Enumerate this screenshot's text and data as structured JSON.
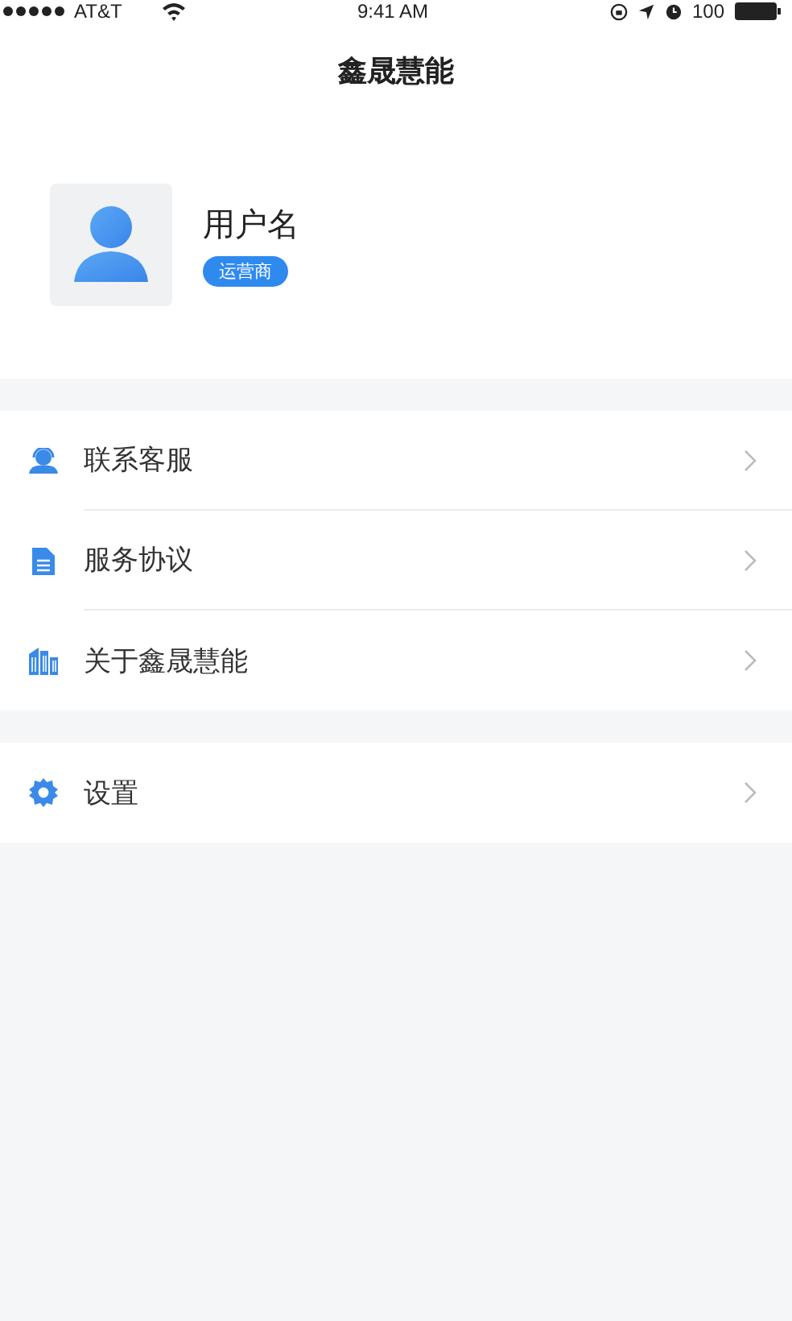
{
  "status_bar": {
    "carrier": "AT&T",
    "time": "9:41 AM",
    "battery": "100"
  },
  "nav_bar": {
    "title": "鑫晟慧能"
  },
  "profile": {
    "name": "用户名",
    "role_badge": "运营商"
  },
  "menu_groups": [
    {
      "items": [
        {
          "kind": "support",
          "label": "联系客服"
        },
        {
          "kind": "document",
          "label": "服务协议"
        },
        {
          "kind": "building",
          "label": "关于鑫晟慧能"
        }
      ]
    },
    {
      "items": [
        {
          "kind": "settings",
          "label": "设置"
        }
      ]
    }
  ]
}
